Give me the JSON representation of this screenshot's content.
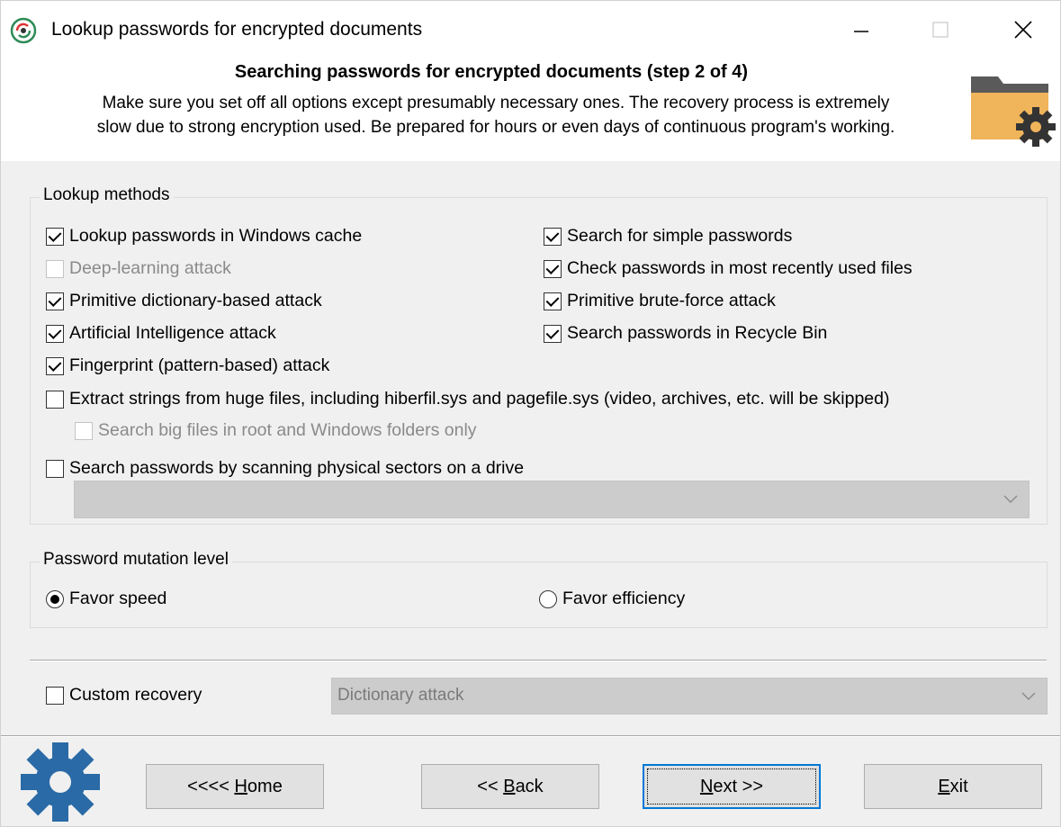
{
  "window": {
    "title": "Lookup passwords for encrypted documents",
    "controls": [
      "minimize",
      "maximize",
      "close"
    ]
  },
  "header": {
    "step_title": "Searching passwords for encrypted documents (step 2 of 4)",
    "description_line1": "Make sure you set off all options except presumably necessary ones. The recovery process is extremely",
    "description_line2": "slow due to strong encryption used. Be prepared for hours or even days of continuous program's working.",
    "icon": "folder-gear-icon"
  },
  "lookup_methods": {
    "label": "Lookup methods",
    "windows_cache": {
      "label": "Lookup passwords in Windows cache",
      "checked": true
    },
    "simple_passwords": {
      "label": "Search for simple passwords",
      "checked": true
    },
    "deep_learning": {
      "label": "Deep-learning attack",
      "checked": false,
      "disabled": true
    },
    "recent_files": {
      "label": "Check passwords in most recently used files",
      "checked": true
    },
    "dictionary_attack": {
      "label": "Primitive dictionary-based attack",
      "checked": true
    },
    "brute_force": {
      "label": "Primitive brute-force attack",
      "checked": true
    },
    "ai_attack": {
      "label": "Artificial Intelligence attack",
      "checked": true
    },
    "recycle_bin": {
      "label": "Search passwords in Recycle Bin",
      "checked": true
    },
    "fingerprint": {
      "label": "Fingerprint (pattern-based) attack",
      "checked": true
    },
    "extract_strings": {
      "label": "Extract strings from huge files, including hiberfil.sys and pagefile.sys (video, archives, etc. will be skipped)",
      "checked": false
    },
    "big_files_root": {
      "label": "Search big files in root and Windows folders only",
      "checked": false,
      "disabled": true
    },
    "physical_sectors": {
      "label": "Search passwords by scanning physical sectors on a drive",
      "checked": false
    },
    "drive_select": {
      "value": "",
      "disabled": true
    }
  },
  "mutation": {
    "label": "Password mutation level",
    "favor_speed": {
      "label": "Favor speed",
      "selected": true
    },
    "favor_efficiency": {
      "label": "Favor efficiency",
      "selected": false
    }
  },
  "custom": {
    "label": "Custom recovery",
    "checked": false,
    "select_value": "Dictionary attack",
    "disabled": true
  },
  "buttons": {
    "home_prefix": "<<<< ",
    "home_key": "H",
    "home_rest": "ome",
    "back_prefix": "<< ",
    "back_key": "B",
    "back_rest": "ack",
    "next_key": "N",
    "next_rest": "ext >>",
    "exit_key": "E",
    "exit_rest": "xit"
  },
  "colors": {
    "accent": "#0078d7",
    "folder": "#f0b45a",
    "gear_dark": "#333333",
    "gear_blue": "#2a6aa6"
  }
}
